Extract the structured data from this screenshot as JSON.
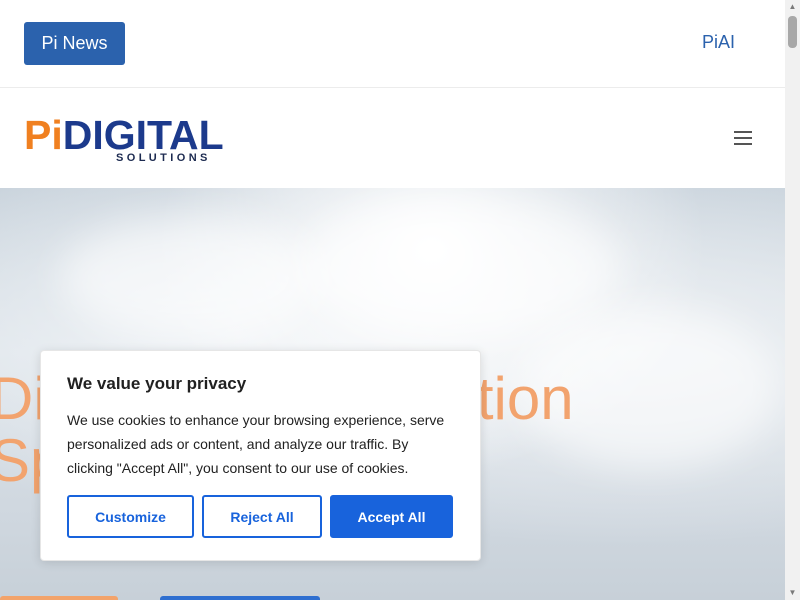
{
  "topbar": {
    "news_button": "Pi News",
    "ai_link": "PiAI"
  },
  "header": {
    "logo": {
      "pi": "Pi",
      "digital": "DIGITAL",
      "sub": "SOLUTIONS"
    },
    "menu_icon": "hamburger-icon"
  },
  "hero": {
    "title_line1": "Digital Transformation",
    "title_line2": "Specialists"
  },
  "cookie": {
    "title": "We value your privacy",
    "text": "We use cookies to enhance your browsing experience, serve personalized ads or content, and analyze our traffic. By clicking \"Accept All\", you consent to our use of cookies.",
    "customize_label": "Customize",
    "reject_label": "Reject All",
    "accept_label": "Accept All"
  },
  "colors": {
    "brand_blue": "#2b62ad",
    "brand_orange": "#f08020",
    "cookie_accent": "#1863dc"
  }
}
